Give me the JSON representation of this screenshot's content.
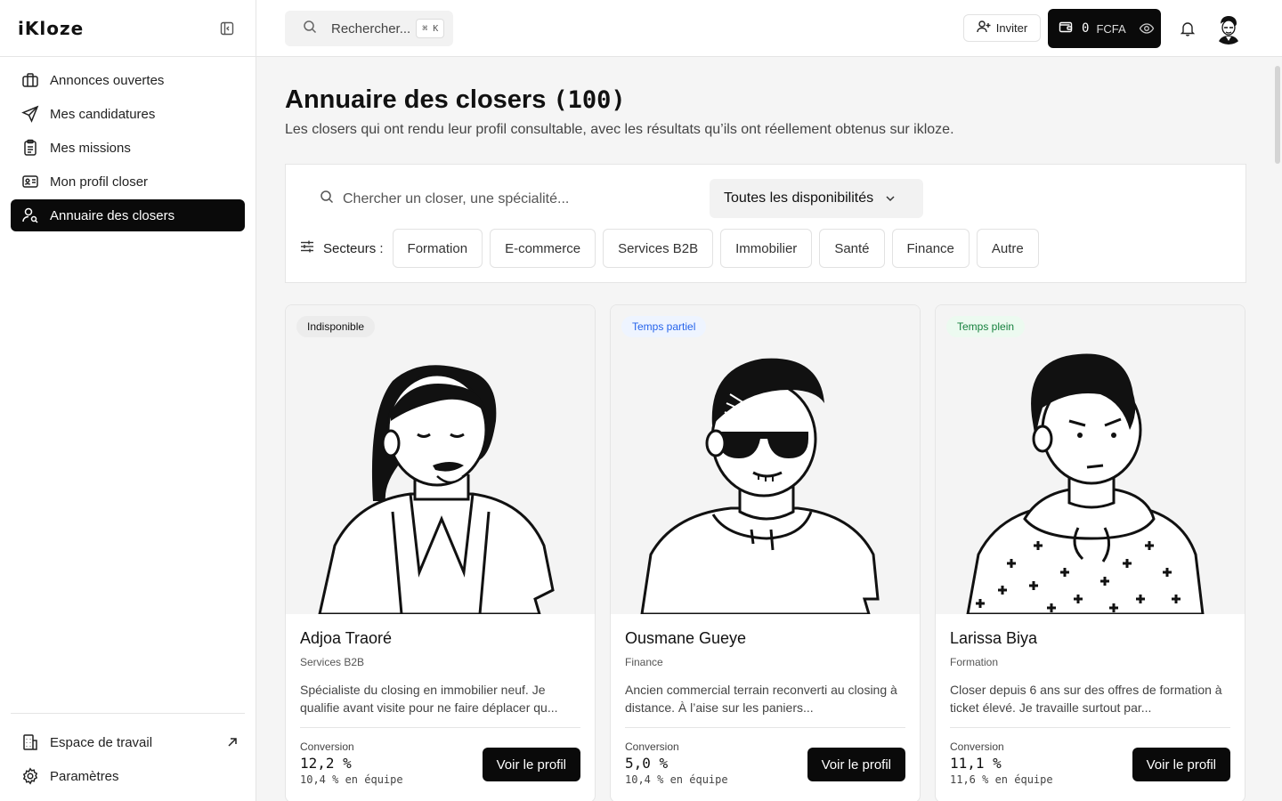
{
  "app": {
    "logo": "iKloze"
  },
  "sidebar": {
    "items": [
      {
        "label": "Annonces ouvertes",
        "icon": "briefcase-icon"
      },
      {
        "label": "Mes candidatures",
        "icon": "send-icon"
      },
      {
        "label": "Mes missions",
        "icon": "clipboard-icon"
      },
      {
        "label": "Mon profil closer",
        "icon": "id-card-icon"
      },
      {
        "label": "Annuaire des closers",
        "icon": "user-search-icon",
        "active": true
      }
    ],
    "footer": [
      {
        "label": "Espace de travail",
        "icon": "building-icon"
      },
      {
        "label": "Paramètres",
        "icon": "gear-icon"
      }
    ]
  },
  "topbar": {
    "search_placeholder": "Rechercher...",
    "shortcut": "⌘ K",
    "invite_label": "Inviter",
    "wallet_amount": "0",
    "wallet_currency": "FCFA"
  },
  "page": {
    "title": "Annuaire des closers",
    "count": "(100)",
    "subtitle": "Les closers qui ont rendu leur profil consultable, avec les résultats qu’ils ont réellement obtenus sur ikloze."
  },
  "filters": {
    "search_placeholder": "Chercher un closer, une spécialité...",
    "availability": "Toutes les disponibilités",
    "sectors_label": "Secteurs :",
    "sectors": [
      "Formation",
      "E-commerce",
      "Services B2B",
      "Immobilier",
      "Santé",
      "Finance",
      "Autre"
    ]
  },
  "closers": [
    {
      "status": "Indisponible",
      "status_color": "#ececec",
      "name": "Adjoa Traoré",
      "sector": "Services B2B",
      "bio": "Spécialiste du closing en immobilier neuf. Je qualifie avant visite pour ne faire déplacer qu...",
      "conversion_label": "Conversion",
      "conversion": "12,2 %",
      "team": "10,4 % en équipe",
      "cta": "Voir le profil"
    },
    {
      "status": "Temps partiel",
      "status_color": "#2563eb",
      "name": "Ousmane Gueye",
      "sector": "Finance",
      "bio": "Ancien commercial terrain reconverti au closing à distance. À l’aise sur les paniers...",
      "conversion_label": "Conversion",
      "conversion": "5,0 %",
      "team": "10,4 % en équipe",
      "cta": "Voir le profil"
    },
    {
      "status": "Temps plein",
      "status_color": "#15803d",
      "name": "Larissa Biya",
      "sector": "Formation",
      "bio": "Closer depuis 6 ans sur des offres de formation à ticket élevé. Je travaille surtout par...",
      "conversion_label": "Conversion",
      "conversion": "11,1 %",
      "team": "11,6 % en équipe",
      "cta": "Voir le profil"
    }
  ]
}
